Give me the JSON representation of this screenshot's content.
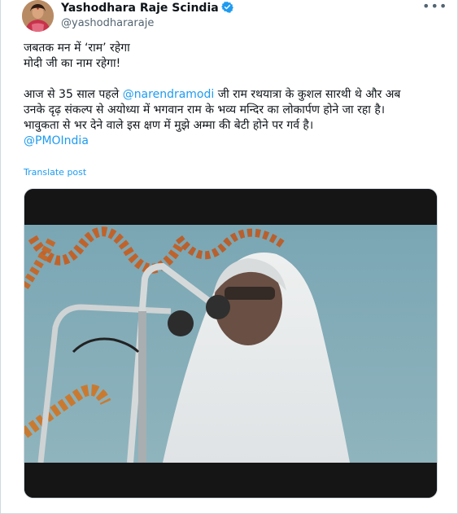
{
  "author": {
    "display_name": "Yashodhara Raje Scindia",
    "handle": "@yashodhararaje",
    "verified": true
  },
  "menu": {
    "more_label": "•••"
  },
  "post": {
    "line1": "जबतक मन में ‘राम’ रहेगा",
    "line2": "मोदी जी का नाम रहेगा!",
    "line3_before": "आज से 35 साल पहले ",
    "line3_mention": "@narendramodi",
    "line3_after": " जी राम रथयात्रा के कुशल सारथी थे और अब",
    "line4": "उनके दृढ़ संकल्प से अयोध्या में भगवान राम के भव्य मन्दिर का लोकार्पण होने जा रहा है।",
    "line5": "भावुकता से भर देने वाले इस क्षण में मुझे अम्मा की बेटी होने पर गर्व है।",
    "line6_mention": "@PMOIndia"
  },
  "translate_label": "Translate post",
  "colors": {
    "link": "#1d9bf0",
    "text": "#0f1419",
    "secondary": "#536471",
    "verified_badge": "#1d9bf0"
  }
}
